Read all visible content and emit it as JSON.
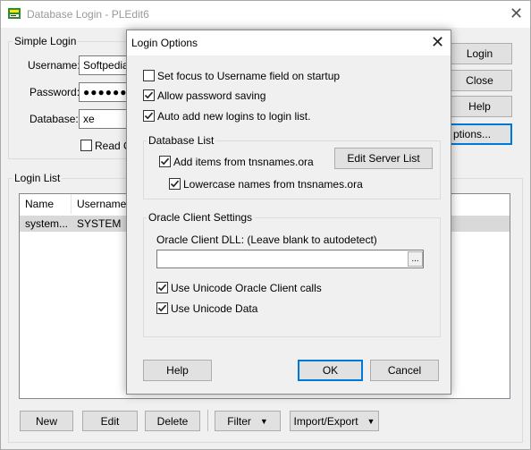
{
  "window": {
    "title": "Database Login - PLEdit6",
    "close_glyph": "✕"
  },
  "simple_login": {
    "group_label": "Simple Login",
    "username_label": "Username:",
    "username_value": "Softpedia",
    "password_label": "Password:",
    "password_value": "●●●●●●",
    "database_label": "Database:",
    "database_value": "xe",
    "read_only_label": "Read O"
  },
  "right_buttons": {
    "login": "Login",
    "close": "Close",
    "help": "Help",
    "options": "ptions..."
  },
  "login_list": {
    "group_label": "Login List",
    "columns": [
      "Name",
      "Username"
    ],
    "rows": [
      {
        "name": "system...",
        "username": "SYSTEM"
      }
    ]
  },
  "bottom_buttons": {
    "new": "New",
    "edit": "Edit",
    "delete": "Delete",
    "filter": "Filter",
    "import_export": "Import/Export",
    "dropdown_glyph": "▼"
  },
  "dialog": {
    "title": "Login Options",
    "close_glyph": "✕",
    "options": {
      "focus_username": {
        "label": "Set focus to Username field on startup",
        "checked": false
      },
      "allow_password": {
        "label": "Allow password saving",
        "checked": true
      },
      "auto_add": {
        "label": "Auto add new logins to login list.",
        "checked": true
      }
    },
    "database_list": {
      "group_label": "Database List",
      "add_items": {
        "label": "Add items from tnsnames.ora",
        "checked": true
      },
      "lowercase": {
        "label": "Lowercase names from tnsnames.ora",
        "checked": true
      },
      "edit_server_list": "Edit Server List"
    },
    "oracle_client": {
      "group_label": "Oracle Client Settings",
      "dll_label": "Oracle Client DLL: (Leave blank to autodetect)",
      "dll_value": "",
      "browse_label": "...",
      "unicode_calls": {
        "label": "Use Unicode Oracle Client calls",
        "checked": true
      },
      "unicode_data": {
        "label": "Use Unicode Data",
        "checked": true
      }
    },
    "buttons": {
      "help": "Help",
      "ok": "OK",
      "cancel": "Cancel"
    }
  }
}
